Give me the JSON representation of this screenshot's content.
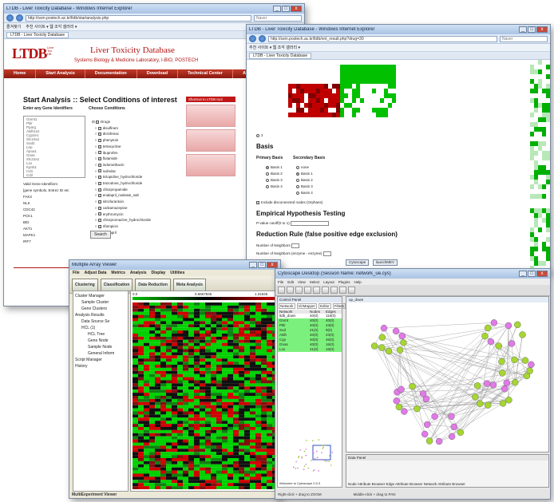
{
  "win1": {
    "title": "LTDB - Liver Toxicity Database - Windows Internet Explorer",
    "url": "http://ssm.postech.ac.kr/ltdb/startanalysis.php",
    "tab": "LTDB - Liver Toxicity Database",
    "favorites": "즐겨찾기",
    "fav_items": "추천 사이트 ▾   웹 조각 갤러리 ▾",
    "search_placeholder": "Naver",
    "logo": "LTDB",
    "logo_sub": "Liver Tox DB",
    "site_title": "Liver Toxicity Database",
    "lab": "Systems Biology & Medicine Laboratory, I-BIO, POSTECH",
    "nav": [
      "Home",
      "Start Analysis",
      "Documentation",
      "Download",
      "Technical Center",
      "About us?"
    ],
    "heading": "Start Analysis :: Select Conditions of interest",
    "gene_label": "Enter any Gene Identifiers",
    "conditions_label": "Choose Conditions",
    "genes": [
      "Gnmt1",
      "Pklr",
      "Pparg",
      "Aldh1a1",
      "Cyp2e1",
      "Slc10a1",
      "Sod2",
      "Lep",
      "Apoa1",
      "Gnas",
      "Slc22a1",
      "Lox",
      "Kpnb1",
      "Cd1",
      "Cd2"
    ],
    "valid_title": "Valid Gene Identifiers:",
    "valid": [
      "[gene symbols, Entrez ID etc",
      "FAK2",
      "NLK",
      "CDC42",
      "PCK1",
      "BID",
      "AKT1",
      "MAPK1",
      "IRF7"
    ],
    "drug_root": "Drugs",
    "drugs": [
      "disulfiram",
      "diclofenac",
      "phenytoin",
      "tetracycline",
      "ibuprofen",
      "flutamide",
      "indomethacin",
      "sulindac",
      "ticlopidine_hydrochloride",
      "trazodone_hydrochloride",
      "chlorpropamide",
      "enalapril_maleate_salt",
      "nitrofurantoin",
      "carbamazepine",
      "erythromycin",
      "chlorpromazine_hydrochloride",
      "rifampicin",
      "captopril"
    ],
    "search_button": "Search",
    "shortcut": "Shortcut to LTDB tool"
  },
  "win2": {
    "title": "LTDB - Liver Toxicity Database - Windows Internet Explorer",
    "url": "http://ssm.postech.ac.kr/ltdb/ont_result.php?drug=30",
    "tab": "LTDB - Liver Toxicity Database",
    "search_placeholder": "Naver",
    "basis_heading": "Basis",
    "primary": "Primary Basis",
    "secondary": "Secondary Basis",
    "primary_opts": [
      "Basis 1",
      "Basis 2",
      "Basis 3",
      "Basis 4"
    ],
    "secondary_opts": [
      "none",
      "Basis 1",
      "Basis 2",
      "Basis 3",
      "Basis 4"
    ],
    "include": "Include disconnected nodes (Orphans)",
    "empirical": "Empirical Hypothesis Testing",
    "pvalue": "P-value cutoff(0 to 1)",
    "reduction": "Reduction Rule (false positive edge exclusion)",
    "neighbors": "Number of Neighbors",
    "neighbors2": "Number of Neighbors (enzyme - enzyme)",
    "btn_cytoscape": "Cytoscape",
    "btn_mev": "launchMEV"
  },
  "win3": {
    "title": "Multiple Array Viewer",
    "menu": [
      "File",
      "Adjust Data",
      "Metrics",
      "Analysis",
      "Display",
      "Utilities"
    ],
    "tools": [
      "Clustering",
      "Classification",
      "Data Reduction",
      "Meta Analysis"
    ],
    "scale_min": "0.0",
    "scale_mid": "0.6667845",
    "scale_max": "1.31845",
    "tree": [
      "Cluster Manager",
      "Sample Cluster",
      "Gene Clusters",
      "Analysis Results",
      "Data Source Se",
      "HCL (1)",
      "HCL Tree",
      "Gene Node",
      "Sample Node",
      "General Inform",
      "Script Manager",
      "History"
    ],
    "status": "MultiExperiment Viewer"
  },
  "win4": {
    "title": "Cytoscape Desktop (Session Name: network_ue.cys)",
    "menu": [
      "File",
      "Edit",
      "View",
      "Select",
      "Layout",
      "Plugins",
      "Help"
    ],
    "panel_title": "Control Panel",
    "panel_tabs": [
      "Network",
      "VizMapper",
      "Editor",
      "Filters"
    ],
    "cols": [
      "Network",
      "Nodes",
      "Edges"
    ],
    "rows": [
      [
        "ltdb_down",
        "40(0)",
        "116(0)"
      ],
      [
        "Gnmt",
        "40(0)",
        "40(0)"
      ],
      [
        "Pklr",
        "40(0)",
        "43(0)"
      ],
      [
        "Sod",
        "21(0)",
        "9(0)"
      ],
      [
        "Aldh",
        "40(0)",
        "43(0)"
      ],
      [
        "Cyp",
        "40(0)",
        "46(0)"
      ],
      [
        "Gnas",
        "40(0)",
        "16(0)"
      ],
      [
        "Lox",
        "21(0)",
        "16(0)"
      ]
    ],
    "data_panel": "Data Panel",
    "welcome": "Welcome to Cytoscape 2.6.3",
    "hint": "Right-click + drag to ZOOM",
    "hint2": "Middle-click + drag to PAN",
    "tabs_bottom": "Node Attribute Browser  Edge Attribute Browser  Network Attribute Browser",
    "net_label": "up_down"
  },
  "colors": {
    "ltdb_red": "#b01515",
    "node_magenta": "#e07ae6",
    "node_lime": "#a6d630",
    "heat_green": "#00d000",
    "heat_red": "#c00000"
  }
}
